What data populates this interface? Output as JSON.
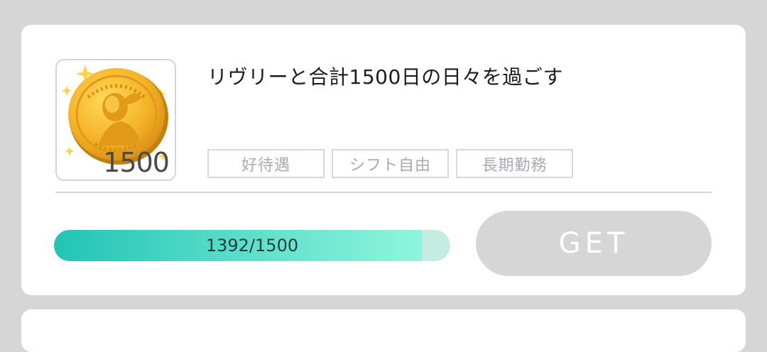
{
  "achievement": {
    "title": "リヴリーと合計1500日の日々を過ごす",
    "coin_amount": "1500",
    "tags": [
      "好待遇",
      "シフト自由",
      "長期勤務"
    ],
    "progress": {
      "current": 1392,
      "target": 1500,
      "label": "1392/1500"
    },
    "get_button_label": "GET"
  },
  "colors": {
    "background": "#d6d6d6",
    "card": "#ffffff",
    "progress_start": "#22c4b6",
    "progress_end": "#8ff5dc",
    "progress_track": "#c4ece0",
    "button_disabled": "#d6d6d6",
    "coin_gold": "#f5b82a"
  }
}
